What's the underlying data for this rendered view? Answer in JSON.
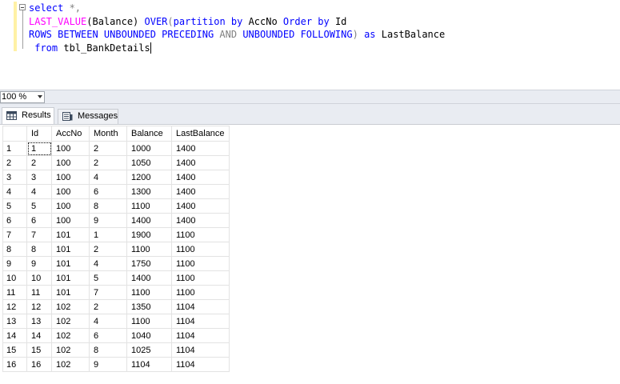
{
  "editor": {
    "line1_kw": "select",
    "line1_rest": " *,",
    "line2": {
      "fn": "LAST_VALUE",
      "arg": "(Balance) ",
      "over": "OVER",
      "p1": "(",
      "partition": "partition by",
      "p2": " AccNo ",
      "order": "Order by",
      "p3": " Id"
    },
    "line3": {
      "rows": "ROWS BETWEEN",
      "unb1": " UNBOUNDED PRECEDING ",
      "and": "AND",
      "unb2": " UNBOUNDED FOLLOWING",
      "close": ") ",
      "as": "as",
      "alias": " LastBalance"
    },
    "line4": {
      "from": "from",
      "table": " tbl_BankDetails"
    }
  },
  "zoom": {
    "value": "100 %"
  },
  "tabs": [
    {
      "label": "Results",
      "icon": "grid-icon"
    },
    {
      "label": "Messages",
      "icon": "messages-icon"
    }
  ],
  "grid": {
    "columns": [
      "Id",
      "AccNo",
      "Month",
      "Balance",
      "LastBalance"
    ],
    "rows": [
      {
        "n": "1",
        "id": "1",
        "acc": "100",
        "month": "2",
        "bal": "1000",
        "last": "1400"
      },
      {
        "n": "2",
        "id": "2",
        "acc": "100",
        "month": "2",
        "bal": "1050",
        "last": "1400"
      },
      {
        "n": "3",
        "id": "3",
        "acc": "100",
        "month": "4",
        "bal": "1200",
        "last": "1400"
      },
      {
        "n": "4",
        "id": "4",
        "acc": "100",
        "month": "6",
        "bal": "1300",
        "last": "1400"
      },
      {
        "n": "5",
        "id": "5",
        "acc": "100",
        "month": "8",
        "bal": "1100",
        "last": "1400"
      },
      {
        "n": "6",
        "id": "6",
        "acc": "100",
        "month": "9",
        "bal": "1400",
        "last": "1400"
      },
      {
        "n": "7",
        "id": "7",
        "acc": "101",
        "month": "1",
        "bal": "1900",
        "last": "1100"
      },
      {
        "n": "8",
        "id": "8",
        "acc": "101",
        "month": "2",
        "bal": "1100",
        "last": "1100"
      },
      {
        "n": "9",
        "id": "9",
        "acc": "101",
        "month": "4",
        "bal": "1750",
        "last": "1100"
      },
      {
        "n": "10",
        "id": "10",
        "acc": "101",
        "month": "5",
        "bal": "1400",
        "last": "1100"
      },
      {
        "n": "11",
        "id": "11",
        "acc": "101",
        "month": "7",
        "bal": "1100",
        "last": "1100"
      },
      {
        "n": "12",
        "id": "12",
        "acc": "102",
        "month": "2",
        "bal": "1350",
        "last": "1104"
      },
      {
        "n": "13",
        "id": "13",
        "acc": "102",
        "month": "4",
        "bal": "1100",
        "last": "1104"
      },
      {
        "n": "14",
        "id": "14",
        "acc": "102",
        "month": "6",
        "bal": "1040",
        "last": "1104"
      },
      {
        "n": "15",
        "id": "15",
        "acc": "102",
        "month": "8",
        "bal": "1025",
        "last": "1104"
      },
      {
        "n": "16",
        "id": "16",
        "acc": "102",
        "month": "9",
        "bal": "1104",
        "last": "1104"
      }
    ]
  }
}
